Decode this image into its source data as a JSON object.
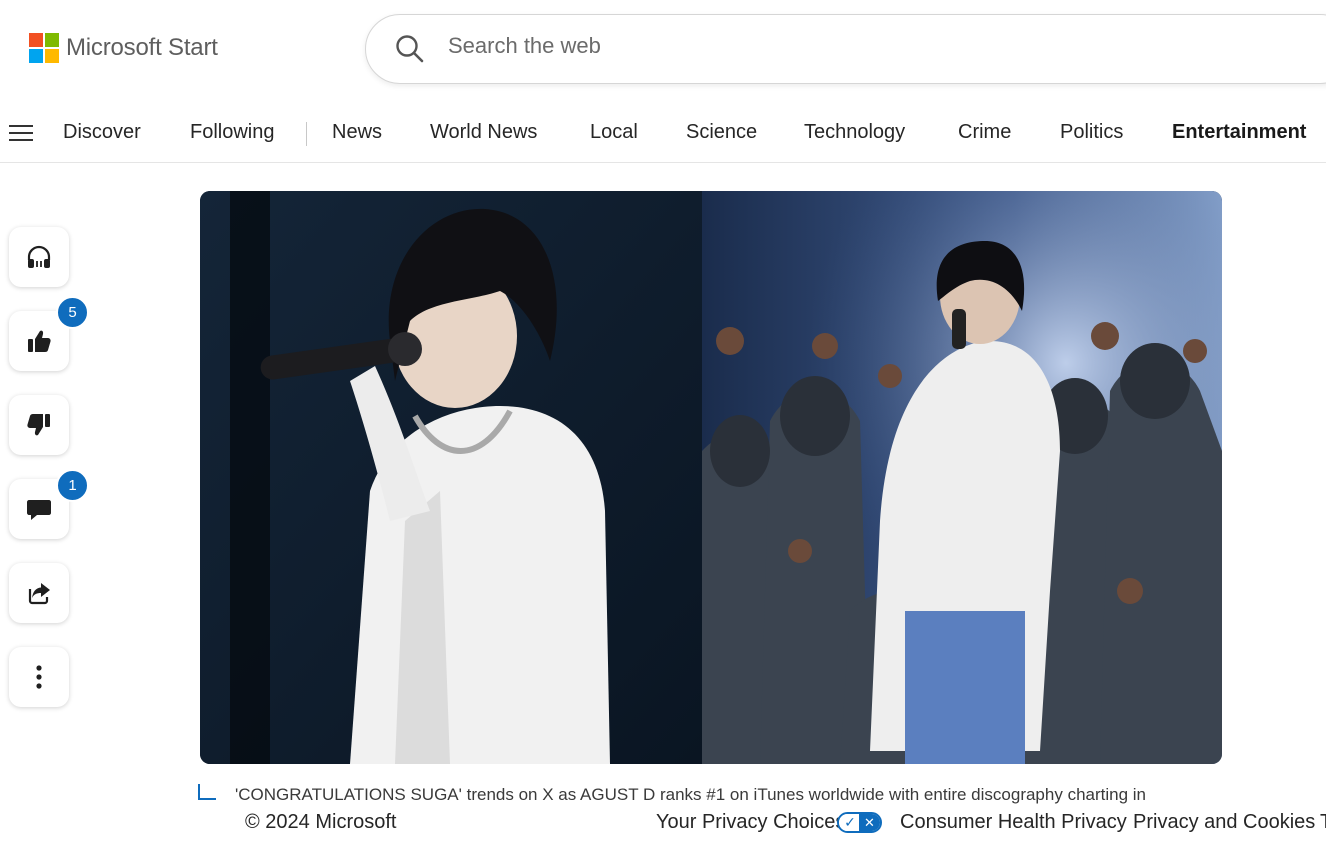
{
  "header": {
    "logo_text": "Microsoft Start",
    "search_placeholder": "Search the web"
  },
  "nav": {
    "items": [
      {
        "label": "Discover"
      },
      {
        "label": "Following"
      },
      {
        "label": "News"
      },
      {
        "label": "World News"
      },
      {
        "label": "Local"
      },
      {
        "label": "Science"
      },
      {
        "label": "Technology"
      },
      {
        "label": "Crime"
      },
      {
        "label": "Politics"
      },
      {
        "label": "Entertainment"
      }
    ],
    "active": "Entertainment"
  },
  "rail": {
    "like_count": "5",
    "comment_count": "1"
  },
  "article": {
    "caption": "'CONGRATULATIONS SUGA' trends on X as AGUST D ranks #1 on iTunes worldwide with entire discography charting in"
  },
  "footer": {
    "copyright": "© 2024 Microsoft",
    "your_privacy_choices": "Your Privacy Choices",
    "consumer_health_privacy": "Consumer Health Privacy",
    "privacy_and_cookies": "Privacy and Cookies",
    "edge_tick": "T"
  },
  "colors": {
    "accent": "#0f6cbd",
    "ms_red": "#f25022",
    "ms_green": "#7fba00",
    "ms_blue": "#00a4ef",
    "ms_yellow": "#ffb900"
  },
  "icons": {
    "listen": "headphones-icon",
    "like": "thumbs-up-icon",
    "dislike": "thumbs-down-icon",
    "comment": "comment-icon",
    "share": "share-icon",
    "more": "more-vertical-icon"
  }
}
